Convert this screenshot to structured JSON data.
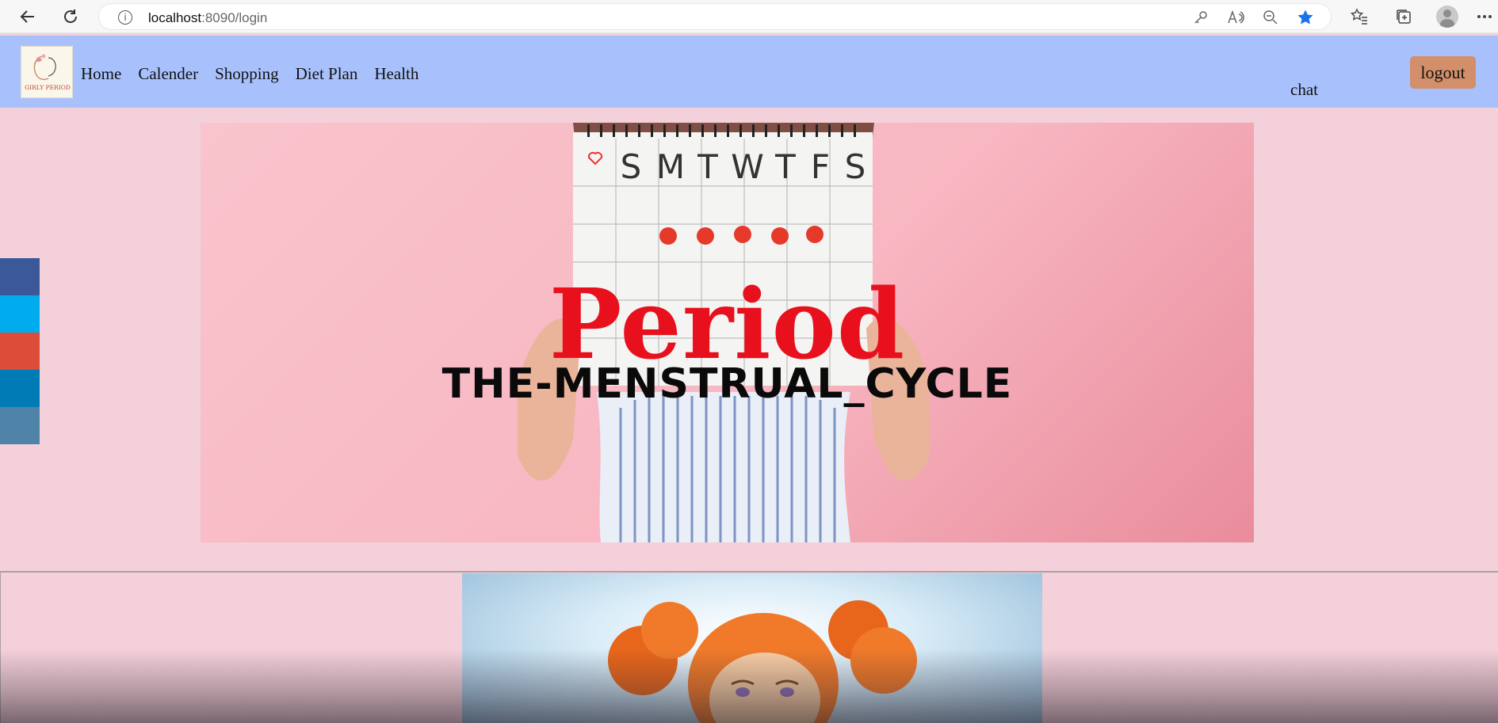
{
  "browser": {
    "url_host": "localhost",
    "url_path": ":8090/login"
  },
  "nav": {
    "menu": [
      "Home",
      "Calender",
      "Shopping",
      "Diet Plan",
      "Health"
    ],
    "chat_label": "chat",
    "logout_label": "logout"
  },
  "logo": {
    "text": "GIRLY PERIOD"
  },
  "social": {
    "colors": [
      "#3b5998",
      "#00aced",
      "#dd4b39",
      "#007bb5",
      "#4f83a7"
    ]
  },
  "hero": {
    "title": "Period",
    "subtitle": "THE-MENSTRUAL_CYCLE",
    "calendar_days": [
      "S",
      "M",
      "T",
      "W",
      "T",
      "F",
      "S"
    ]
  },
  "colors": {
    "page_bg": "#f4d0db",
    "nav_bg": "#a8c1fd",
    "logout_bg": "#d38f6a",
    "title_red": "#e8101c"
  }
}
